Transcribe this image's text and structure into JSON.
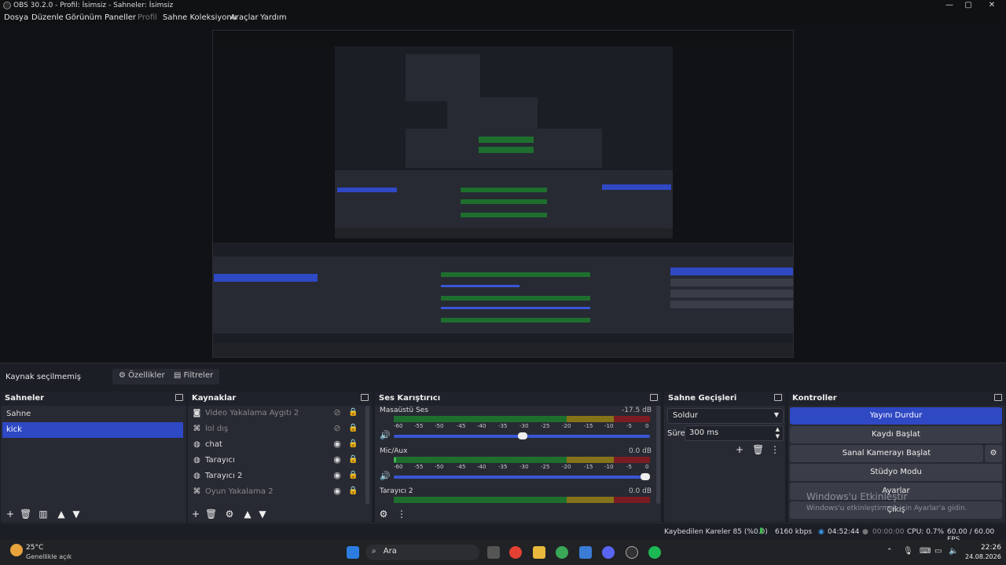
{
  "titlebar": {
    "title": "OBS 30.2.0 - Profil: İsimsiz - Sahneler: İsimsiz",
    "minimize": "—",
    "maximize": "▢",
    "close": "✕"
  },
  "menu": [
    "Dosya",
    "Düzenle",
    "Görünüm",
    "Paneller",
    "Profil",
    "Sahne Koleksiyonu",
    "Araçlar",
    "Yardım"
  ],
  "context": {
    "status": "Kaynak seçilmemiş",
    "properties": "Özellikler",
    "filters": "Filtreler"
  },
  "docks": {
    "scenes": {
      "title": "Sahneler",
      "items": [
        "Sahne",
        "kick"
      ],
      "selected": "kick"
    },
    "sources": {
      "title": "Kaynaklar",
      "items": [
        {
          "label": "Video Yakalama Aygıtı 2",
          "visible": false,
          "icon": "camera-icon"
        },
        {
          "label": "lol dış",
          "visible": false,
          "icon": "gamepad-icon"
        },
        {
          "label": "chat",
          "visible": true,
          "icon": "globe-icon"
        },
        {
          "label": "Tarayıcı",
          "visible": true,
          "icon": "globe-icon"
        },
        {
          "label": "Tarayıcı 2",
          "visible": true,
          "icon": "globe-icon"
        },
        {
          "label": "Oyun Yakalama 2",
          "visible": true,
          "icon": "gamepad-icon"
        }
      ]
    },
    "mixer": {
      "title": "Ses Karıştırıcı",
      "scale": [
        "-60",
        "-55",
        "-50",
        "-45",
        "-40",
        "-35",
        "-30",
        "-25",
        "-20",
        "-15",
        "-10",
        "-5",
        "0"
      ],
      "channels": [
        {
          "name": "Masaüstü Ses",
          "db": "-17.5 dB",
          "level": 0.0,
          "volume": 0.62
        },
        {
          "name": "Mic/Aux",
          "db": "0.0 dB",
          "level": 0.01,
          "volume": 1.0
        },
        {
          "name": "Tarayıcı 2",
          "db": "0.0 dB",
          "level": 0.0,
          "volume": 1.0
        }
      ]
    },
    "transitions": {
      "title": "Sahne Geçişleri",
      "selected": "Soldur",
      "duration_label": "Süre",
      "duration": "300 ms"
    },
    "controls": {
      "title": "Kontroller",
      "buttons": [
        "Yayını Durdur",
        "Kaydı Başlat",
        "Sanal Kamerayı Başlat",
        "Stüdyo Modu",
        "Ayarlar",
        "Çıkış"
      ]
    }
  },
  "watermark": {
    "line1": "Windows'u Etkinleştir",
    "line2": "Windows'u etkinleştirmek için Ayarlar'a gidin."
  },
  "status": {
    "dropped": "Kaybedilen Kareler 85 (%0.0)",
    "bitrate": "6160 kbps",
    "stream_time": "04:52:44",
    "rec_time": "00:00:00",
    "cpu": "CPU: 0.7%",
    "fps": "60.00 / 60.00 FPS"
  },
  "taskbar": {
    "weather_temp": "25°C",
    "weather_desc": "Genellikle açık",
    "search": "Ara",
    "time": "22:26",
    "date": "24.08.2026"
  },
  "colors": {
    "accent": "#2f48c4",
    "panel": "#272a33",
    "bg": "#1c1e26"
  }
}
